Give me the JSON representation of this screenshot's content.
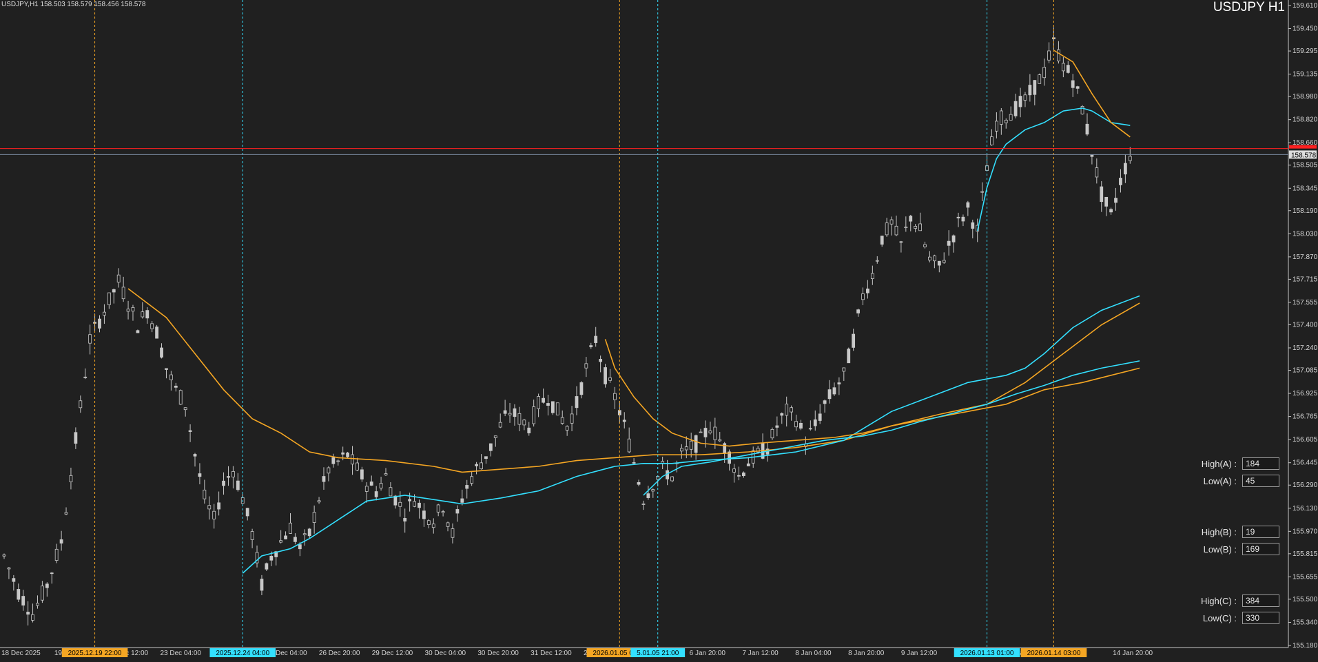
{
  "window": {
    "title_text": "USDJPY,H1  158.503 158.579 158.456 158.578",
    "symbol_label": "USDJPY H1"
  },
  "colors": {
    "background": "#202020",
    "candle": "#c8c8c8",
    "orange": "#f5a623",
    "cyan": "#33e0ff",
    "red_line": "#ff2020",
    "bid_line": "#7a8aa0"
  },
  "chart_data": {
    "type": "candlestick",
    "symbol": "USDJPY",
    "timeframe": "H1",
    "ylim": [
      155.18,
      159.61
    ],
    "y_ticks": [
      159.61,
      159.45,
      159.295,
      159.135,
      158.98,
      158.82,
      158.66,
      158.505,
      158.345,
      158.19,
      158.03,
      157.87,
      157.715,
      157.555,
      157.4,
      157.24,
      157.085,
      156.925,
      156.765,
      156.605,
      156.445,
      156.29,
      156.13,
      155.97,
      155.815,
      155.655,
      155.5,
      155.34,
      155.18
    ],
    "y_tick_labels": [
      "159.610",
      "159.450",
      "159.295",
      "159.135",
      "158.980",
      "158.820",
      "158.660",
      "158.505",
      "158.345",
      "158.190",
      "158.030",
      "157.870",
      "157.715",
      "157.555",
      "157.400",
      "157.240",
      "157.085",
      "156.925",
      "156.765",
      "156.605",
      "156.445",
      "156.290",
      "156.130",
      "155.970",
      "155.815",
      "155.655",
      "155.500",
      "155.340",
      "155.180"
    ],
    "x_labels": [
      "18 Dec 2025",
      "19 Dec",
      "22 Dec 12:00",
      "23 Dec 04:00",
      "Dec 12:00",
      "26 Dec 04:00",
      "26 Dec 20:00",
      "29 Dec 12:00",
      "30 Dec 04:00",
      "30 Dec 20:00",
      "31 Dec 12:00",
      "2 Jan 04:00",
      "an 04:00",
      "6 Jan 20:00",
      "7 Jan 12:00",
      "8 Jan 04:00",
      "8 Jan 20:00",
      "9 Jan 12:00",
      "12 Jan 04:",
      "13 Ja",
      ":00",
      "14 Jan 20:00"
    ],
    "current_price": 158.578,
    "current_price_label": "158.578",
    "red_line_price": 158.62,
    "price_path": [
      [
        0,
        155.8
      ],
      [
        3,
        155.55
      ],
      [
        6,
        155.4
      ],
      [
        9,
        155.6
      ],
      [
        12,
        155.9
      ],
      [
        15,
        156.6
      ],
      [
        18,
        157.3
      ],
      [
        21,
        157.5
      ],
      [
        24,
        157.7
      ],
      [
        26,
        157.55
      ],
      [
        28,
        157.4
      ],
      [
        30,
        157.5
      ],
      [
        32,
        157.35
      ],
      [
        34,
        157.1
      ],
      [
        36,
        156.95
      ],
      [
        38,
        156.85
      ],
      [
        40,
        156.5
      ],
      [
        42,
        156.2
      ],
      [
        44,
        156.05
      ],
      [
        46,
        156.3
      ],
      [
        48,
        156.4
      ],
      [
        50,
        156.2
      ],
      [
        52,
        155.95
      ],
      [
        54,
        155.6
      ],
      [
        56,
        155.8
      ],
      [
        58,
        155.9
      ],
      [
        60,
        156.0
      ],
      [
        62,
        155.85
      ],
      [
        64,
        155.95
      ],
      [
        66,
        156.2
      ],
      [
        68,
        156.4
      ],
      [
        70,
        156.45
      ],
      [
        72,
        156.5
      ],
      [
        74,
        156.4
      ],
      [
        76,
        156.3
      ],
      [
        78,
        156.25
      ],
      [
        80,
        156.35
      ],
      [
        82,
        156.2
      ],
      [
        84,
        156.1
      ],
      [
        86,
        156.2
      ],
      [
        88,
        156.1
      ],
      [
        90,
        156.05
      ],
      [
        92,
        156.15
      ],
      [
        94,
        155.95
      ],
      [
        96,
        156.2
      ],
      [
        98,
        156.35
      ],
      [
        100,
        156.45
      ],
      [
        102,
        156.55
      ],
      [
        104,
        156.7
      ],
      [
        106,
        156.8
      ],
      [
        108,
        156.75
      ],
      [
        110,
        156.7
      ],
      [
        112,
        156.85
      ],
      [
        114,
        156.9
      ],
      [
        116,
        156.8
      ],
      [
        118,
        156.7
      ],
      [
        120,
        156.85
      ],
      [
        122,
        157.1
      ],
      [
        124,
        157.3
      ],
      [
        126,
        157.05
      ],
      [
        128,
        156.9
      ],
      [
        130,
        156.7
      ],
      [
        132,
        156.45
      ],
      [
        134,
        156.2
      ],
      [
        136,
        156.3
      ],
      [
        138,
        156.4
      ],
      [
        140,
        156.35
      ],
      [
        142,
        156.5
      ],
      [
        144,
        156.55
      ],
      [
        146,
        156.6
      ],
      [
        148,
        156.7
      ],
      [
        150,
        156.6
      ],
      [
        152,
        156.5
      ],
      [
        154,
        156.35
      ],
      [
        156,
        156.45
      ],
      [
        158,
        156.5
      ],
      [
        160,
        156.55
      ],
      [
        162,
        156.7
      ],
      [
        164,
        156.8
      ],
      [
        166,
        156.75
      ],
      [
        168,
        156.6
      ],
      [
        170,
        156.7
      ],
      [
        172,
        156.85
      ],
      [
        174,
        156.95
      ],
      [
        176,
        157.05
      ],
      [
        178,
        157.3
      ],
      [
        180,
        157.6
      ],
      [
        182,
        157.75
      ],
      [
        184,
        158.0
      ],
      [
        186,
        158.1
      ],
      [
        188,
        157.95
      ],
      [
        190,
        158.15
      ],
      [
        192,
        158.05
      ],
      [
        194,
        157.85
      ],
      [
        196,
        157.8
      ],
      [
        198,
        157.95
      ],
      [
        200,
        158.1
      ],
      [
        202,
        158.2
      ],
      [
        204,
        158.05
      ],
      [
        206,
        158.5
      ],
      [
        208,
        158.8
      ],
      [
        210,
        158.85
      ],
      [
        212,
        158.9
      ],
      [
        214,
        158.95
      ],
      [
        216,
        159.05
      ],
      [
        218,
        159.15
      ],
      [
        220,
        159.35
      ],
      [
        222,
        159.2
      ],
      [
        224,
        159.1
      ],
      [
        226,
        158.9
      ],
      [
        228,
        158.6
      ],
      [
        230,
        158.3
      ],
      [
        232,
        158.15
      ],
      [
        234,
        158.4
      ],
      [
        236,
        158.58
      ]
    ],
    "series": [
      {
        "color": "orange",
        "values": [
          [
            26,
            157.65
          ],
          [
            34,
            157.45
          ],
          [
            40,
            157.2
          ],
          [
            46,
            156.95
          ],
          [
            52,
            156.75
          ],
          [
            58,
            156.65
          ],
          [
            64,
            156.52
          ],
          [
            70,
            156.48
          ],
          [
            80,
            156.46
          ],
          [
            90,
            156.42
          ],
          [
            96,
            156.38
          ],
          [
            104,
            156.4
          ],
          [
            112,
            156.42
          ],
          [
            120,
            156.46
          ],
          [
            128,
            156.48
          ],
          [
            136,
            156.5
          ],
          [
            146,
            156.5
          ],
          [
            156,
            156.52
          ],
          [
            166,
            156.55
          ],
          [
            176,
            156.6
          ],
          [
            186,
            156.7
          ],
          [
            196,
            156.78
          ],
          [
            206,
            156.85
          ],
          [
            214,
            157.0
          ],
          [
            222,
            157.2
          ],
          [
            230,
            157.4
          ],
          [
            238,
            157.55
          ]
        ]
      },
      {
        "color": "cyan",
        "values": [
          [
            50,
            155.68
          ],
          [
            54,
            155.8
          ],
          [
            60,
            155.85
          ],
          [
            64,
            155.92
          ],
          [
            70,
            156.05
          ],
          [
            76,
            156.18
          ],
          [
            84,
            156.22
          ],
          [
            92,
            156.18
          ],
          [
            96,
            156.16
          ],
          [
            104,
            156.2
          ],
          [
            112,
            156.25
          ],
          [
            120,
            156.35
          ],
          [
            128,
            156.42
          ],
          [
            134,
            156.44
          ],
          [
            140,
            156.44
          ],
          [
            146,
            156.46
          ],
          [
            156,
            156.48
          ],
          [
            166,
            156.52
          ],
          [
            176,
            156.6
          ],
          [
            186,
            156.8
          ],
          [
            194,
            156.9
          ],
          [
            202,
            157.0
          ],
          [
            210,
            157.05
          ],
          [
            214,
            157.1
          ],
          [
            218,
            157.2
          ],
          [
            224,
            157.38
          ],
          [
            230,
            157.5
          ],
          [
            238,
            157.6
          ]
        ]
      },
      {
        "color": "orange",
        "values": [
          [
            126,
            157.3
          ],
          [
            128,
            157.1
          ],
          [
            132,
            156.9
          ],
          [
            136,
            156.75
          ],
          [
            140,
            156.65
          ],
          [
            146,
            156.58
          ],
          [
            152,
            156.56
          ],
          [
            158,
            156.58
          ],
          [
            166,
            156.6
          ],
          [
            174,
            156.62
          ],
          [
            180,
            156.65
          ],
          [
            186,
            156.7
          ],
          [
            194,
            156.75
          ],
          [
            202,
            156.8
          ],
          [
            210,
            156.85
          ],
          [
            218,
            156.95
          ],
          [
            226,
            157.0
          ],
          [
            232,
            157.05
          ],
          [
            238,
            157.1
          ]
        ]
      },
      {
        "color": "cyan",
        "values": [
          [
            134,
            156.22
          ],
          [
            138,
            156.35
          ],
          [
            142,
            156.42
          ],
          [
            148,
            156.45
          ],
          [
            156,
            156.5
          ],
          [
            164,
            156.55
          ],
          [
            172,
            156.6
          ],
          [
            180,
            156.63
          ],
          [
            186,
            156.67
          ],
          [
            192,
            156.73
          ],
          [
            198,
            156.78
          ],
          [
            206,
            156.85
          ],
          [
            212,
            156.92
          ],
          [
            218,
            156.98
          ],
          [
            224,
            157.05
          ],
          [
            230,
            157.1
          ],
          [
            238,
            157.15
          ]
        ]
      },
      {
        "color": "cyan",
        "values": [
          [
            204,
            158.05
          ],
          [
            206,
            158.35
          ],
          [
            208,
            158.55
          ],
          [
            210,
            158.65
          ],
          [
            214,
            158.75
          ],
          [
            218,
            158.8
          ],
          [
            222,
            158.88
          ],
          [
            226,
            158.9
          ],
          [
            228,
            158.88
          ],
          [
            232,
            158.8
          ],
          [
            236,
            158.78
          ]
        ]
      },
      {
        "color": "orange",
        "values": [
          [
            220,
            159.3
          ],
          [
            224,
            159.22
          ],
          [
            228,
            159.0
          ],
          [
            232,
            158.8
          ],
          [
            236,
            158.7
          ]
        ]
      }
    ],
    "orange_markers": [
      {
        "label": "2025.12.19 22:00",
        "index": 19
      },
      {
        "label": "2026.01.05 06:00",
        "index": 129
      },
      {
        "label": "2026.01.14 03:00",
        "index": 220
      }
    ],
    "cyan_markers": [
      {
        "label": "2025.12.24 04:00",
        "index": 50
      },
      {
        "label": "5.01.05 21:00",
        "index": 137
      },
      {
        "label": "2026.01.13 01:00",
        "index": 206
      }
    ],
    "n_bars": 240
  },
  "panel": {
    "high_a_label": "High(A) :",
    "high_a_value": "184",
    "low_a_label": "Low(A) :",
    "low_a_value": "45",
    "high_b_label": "High(B) :",
    "high_b_value": "19",
    "low_b_label": "Low(B) :",
    "low_b_value": "169",
    "high_c_label": "High(C) :",
    "high_c_value": "384",
    "low_c_label": "Low(C) :",
    "low_c_value": "330"
  }
}
